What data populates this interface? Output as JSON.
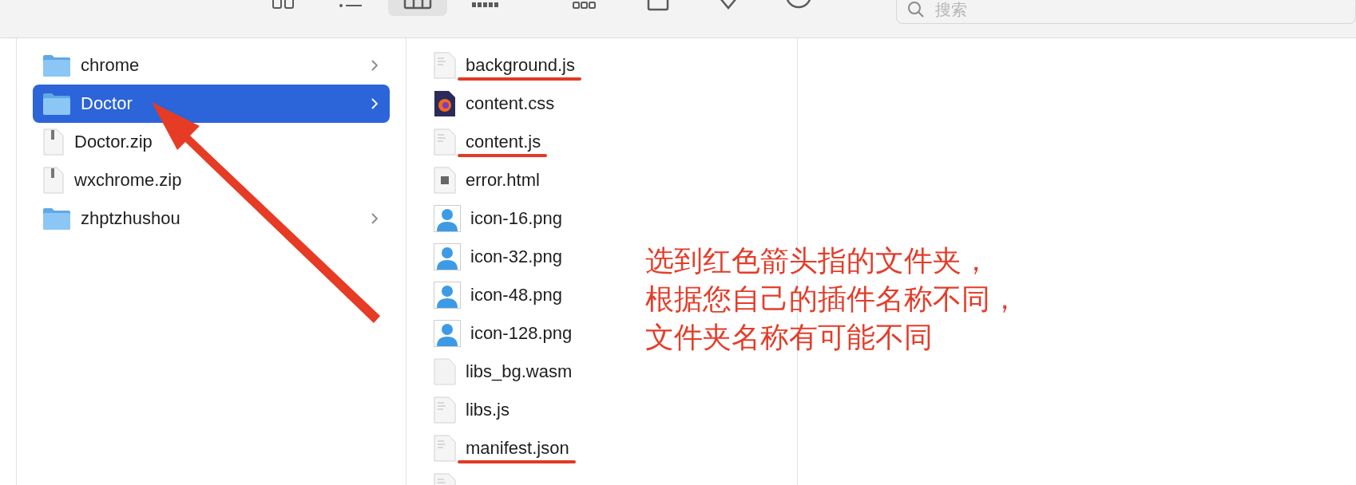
{
  "toolbar": {
    "view_buttons": [
      {
        "kind": "icons",
        "selected": false
      },
      {
        "kind": "list",
        "selected": false
      },
      {
        "kind": "columns",
        "selected": true
      },
      {
        "kind": "gallery",
        "selected": false
      }
    ],
    "actions": [
      {
        "kind": "group"
      },
      {
        "kind": "share"
      },
      {
        "kind": "tag"
      },
      {
        "kind": "more"
      }
    ],
    "search": {
      "placeholder": "搜索"
    }
  },
  "columns": [
    {
      "items": [
        {
          "name": "chrome",
          "kind": "folder",
          "selected": false
        },
        {
          "name": "Doctor",
          "kind": "folder",
          "selected": true
        },
        {
          "name": "Doctor.zip",
          "kind": "zip",
          "selected": false
        },
        {
          "name": "wxchrome.zip",
          "kind": "zip",
          "selected": false
        },
        {
          "name": "zhptzhushou",
          "kind": "folder",
          "selected": false
        }
      ]
    },
    {
      "items": [
        {
          "name": "background.js",
          "kind": "js",
          "selected": false,
          "underlined": true
        },
        {
          "name": "content.css",
          "kind": "css",
          "selected": false,
          "underlined": false
        },
        {
          "name": "content.js",
          "kind": "js",
          "selected": false,
          "underlined": true
        },
        {
          "name": "error.html",
          "kind": "html",
          "selected": false,
          "underlined": false
        },
        {
          "name": "icon-16.png",
          "kind": "image",
          "selected": false,
          "underlined": false
        },
        {
          "name": "icon-32.png",
          "kind": "image",
          "selected": false,
          "underlined": false
        },
        {
          "name": "icon-48.png",
          "kind": "image",
          "selected": false,
          "underlined": false
        },
        {
          "name": "icon-128.png",
          "kind": "image",
          "selected": false,
          "underlined": false
        },
        {
          "name": "libs_bg.wasm",
          "kind": "blank",
          "selected": false,
          "underlined": false
        },
        {
          "name": "libs.js",
          "kind": "js",
          "selected": false,
          "underlined": false
        },
        {
          "name": "manifest.json",
          "kind": "json",
          "selected": false,
          "underlined": true
        },
        {
          "kind": "js",
          "selected": false
        }
      ]
    }
  ],
  "annotation": {
    "lines": [
      "选到红色箭头指的文件夹，",
      "根据您自己的插件名称不同，",
      "文件夹名称有可能不同"
    ]
  }
}
